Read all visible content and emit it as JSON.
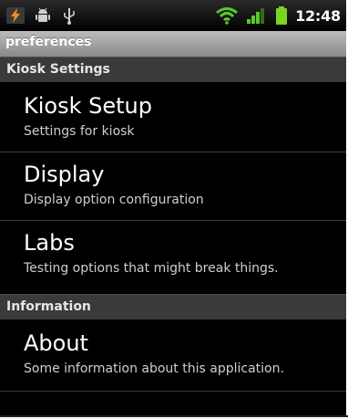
{
  "status_bar": {
    "time": "12:48",
    "icons": [
      "flash-icon",
      "android-debug-icon",
      "usb-icon",
      "wifi-icon",
      "signal-icon",
      "battery-icon"
    ]
  },
  "title_bar": {
    "title": "preferences"
  },
  "categories": [
    {
      "label": "Kiosk Settings",
      "items": [
        {
          "title": "Kiosk Setup",
          "summary": "Settings for kiosk"
        },
        {
          "title": "Display",
          "summary": "Display option configuration"
        },
        {
          "title": "Labs",
          "summary": "Testing options that might break things."
        }
      ]
    },
    {
      "label": "Information",
      "items": [
        {
          "title": "About",
          "summary": "Some information about this application."
        }
      ]
    }
  ],
  "colors": {
    "background": "#000000",
    "battery": "#7ed321",
    "wifi": "#58c828",
    "title_bar": "#a6a6a6"
  }
}
